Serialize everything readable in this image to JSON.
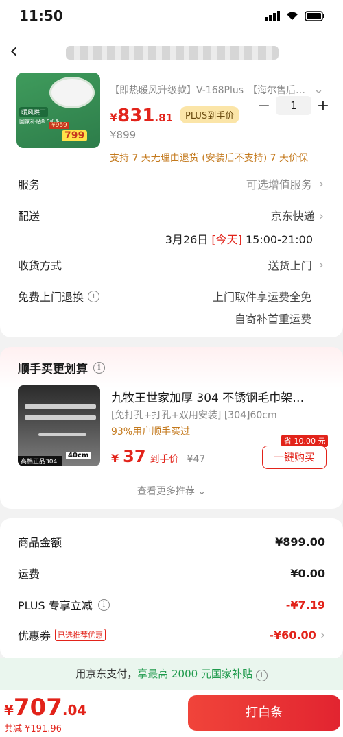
{
  "status": {
    "time": "11:50"
  },
  "product": {
    "variant": "【即热暖风升级款】V-168Plus",
    "warranty": "【海尔售后…",
    "price_currency": "¥",
    "price_int": "831",
    "price_dec": ".81",
    "plus_label": "PLUS到手价",
    "orig_price": "¥899",
    "qty": "1",
    "return_policy": "支持 7 天无理由退货 (安装后不支持)  7 天价保",
    "thumb_tag1": "暖风烘干",
    "thumb_tag2": "国家补贴8.5折起",
    "thumb_price1": "¥959",
    "thumb_price2": "799"
  },
  "rows": {
    "service_label": "服务",
    "service_value": "可选增值服务",
    "delivery_label": "配送",
    "delivery_value": "京东快递",
    "delivery_date": "3月26日",
    "delivery_today": "[今天]",
    "delivery_time": "15:00-21:00",
    "receive_label": "收货方式",
    "receive_value": "送货上门",
    "return_label": "免费上门退换",
    "return_value1": "上门取件享运费全免",
    "return_value2": "自寄补首重运费"
  },
  "rec": {
    "title": "顺手买更划算",
    "name": "九牧王世家加厚 304 不锈钢毛巾架…",
    "spec": "[免打孔+打孔+双用安装]  [304]60cm",
    "pct": "93%用户顺手买过",
    "price_currency": "¥",
    "price": "37",
    "price_unit": "到手价",
    "ref_price": "¥47",
    "save_badge": "省 10.00 元",
    "buy_label": "一键购买",
    "more_label": "查看更多推荐 ⌄",
    "img_tag1": "高档正品304",
    "img_tag2": "40cm"
  },
  "summary": {
    "goods_label": "商品金额",
    "goods_value": "¥899.00",
    "ship_label": "运费",
    "ship_value": "¥0.00",
    "plus_label": "PLUS 专享立减",
    "plus_value": "-¥7.19",
    "coupon_label": "优惠券",
    "coupon_tag": "已选推荐优惠",
    "coupon_value": "-¥60.00"
  },
  "pay_note": {
    "prefix": "用京东支付，",
    "highlight": "享最高 2000 元国家补贴"
  },
  "bottom": {
    "currency": "¥",
    "total_int": "707",
    "total_dec": ".04",
    "discount": "共减 ¥191.96",
    "pay_button": "打白条"
  }
}
